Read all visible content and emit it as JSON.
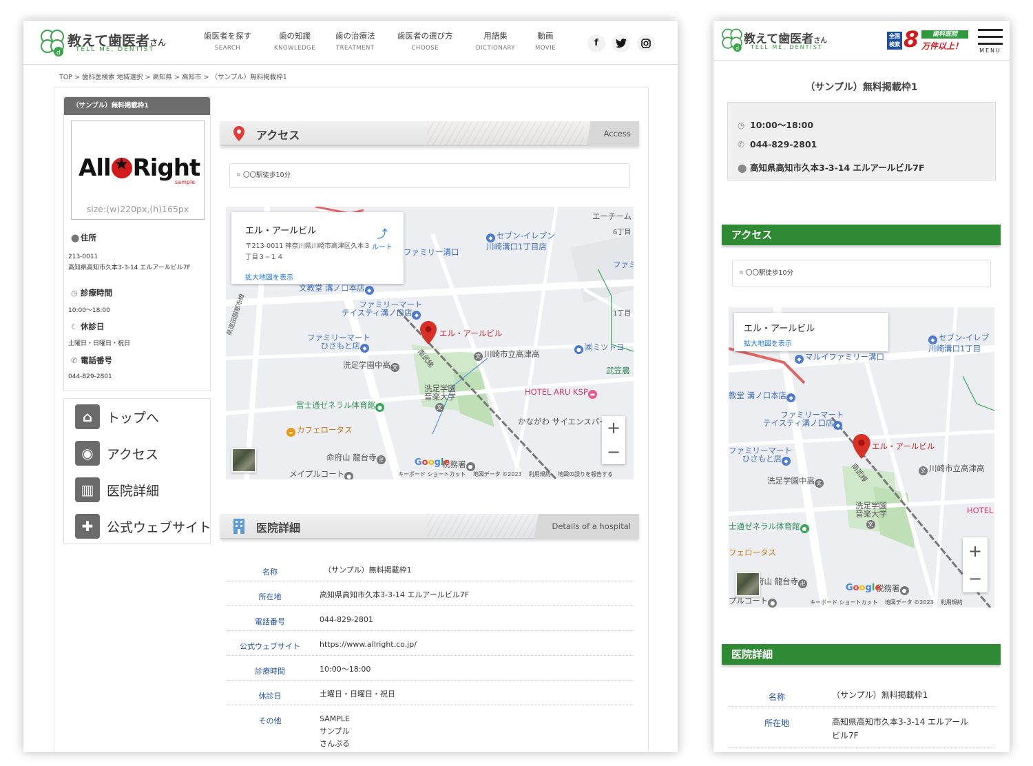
{
  "brand": {
    "name": "教えて歯医者",
    "name_suffix": "さん",
    "tagline": "TELL ME, DENTIST"
  },
  "nav": [
    {
      "jp": "歯医者を探す",
      "en": "SEARCH"
    },
    {
      "jp": "歯の知識",
      "en": "KNOWLEDGE"
    },
    {
      "jp": "歯の治療法",
      "en": "TREATMENT"
    },
    {
      "jp": "歯医者の選び方",
      "en": "CHOOSE"
    },
    {
      "jp": "用語集",
      "en": "DICTIONARY"
    },
    {
      "jp": "動画",
      "en": "MOVIE"
    }
  ],
  "sns": {
    "facebook": "f",
    "twitter": "t",
    "instagram": "◎"
  },
  "breadcrumb": "TOP > 歯科医検索 地域選択 > 高知県 > 高知市 > （サンプル）無料掲載枠1",
  "clinic": {
    "card_title": "（サンプル）無料掲載枠1",
    "title": "（サンプル）無料掲載枠1",
    "logo_text_left": "All",
    "logo_text_right": "Right",
    "logo_sample": "sample",
    "image_size_note": "size:(w)220px,(h)165px",
    "address_label": "住所",
    "postal": "213-0011",
    "address": "高知県高知市久本3-3-14 エルアールビル7F",
    "hours_label": "診療時間",
    "hours": "10:00〜18:00",
    "closed_label": "休診日",
    "closed": "土曜日・日曜日・祝日",
    "phone_label": "電話番号",
    "phone": "044-829-2801"
  },
  "side_nav": [
    {
      "label": "トップへ",
      "icon": "home-icon"
    },
    {
      "label": "アクセス",
      "icon": "pin-icon"
    },
    {
      "label": "医院詳細",
      "icon": "building-icon"
    },
    {
      "label": "公式ウェブサイト",
      "icon": "plus-icon"
    }
  ],
  "access": {
    "title": "アクセス",
    "en": "Access",
    "walk": "〇〇駅徒歩10分"
  },
  "map": {
    "place_name": "エル・アールビル",
    "place_address": "〒213-0011 神奈川県川崎市高津区久本３丁目３−１４",
    "enlarge_link": "拡大地図を表示",
    "route": "ルート",
    "labels": {
      "seven": "セブン-イレブン\n川崎溝口1丁目店",
      "seven_m": "セブン-イレブ\n川崎溝口1丁目",
      "famima_mizonokuchi": "ファミリー溝口",
      "famima_mizonokuchi_m": "マルイファミリー溝口",
      "bunkyodo": "文教堂 溝ノ口本店",
      "bunkyodo_m": "教堂 溝ノ口本店",
      "famima_teisty": "ファミリーマート\nテイスティ溝ノ口店",
      "famima_hisamoto": "ファミリーマート\nひさもと店",
      "pin": "エル・アールビル",
      "kawasaki_high": "川崎市立高津高",
      "senzoku_mid": "洗足学園中高",
      "senzoku_music": "洗足学園\n音楽大学",
      "fujitsu": "富士通ゼネラル体育館",
      "fujitsu_m": "士通ゼネラル体育館",
      "cafe": "カフェロータス",
      "cafe_m": "フェロータス",
      "ryodaiji": "命府山 龍台寺",
      "ryodaiji_m": "府山 龍台寺",
      "maple": "メイプルコート",
      "maple_m": "プルコート",
      "hotel": "HOTEL ARU KSP",
      "hotel_m": "HOTEL",
      "science_park": "かながわ\nサイエンスパーク",
      "zeimusho": "税務署",
      "mitsutoyo": "㈱ミツトヨ",
      "takezasa": "武笠農",
      "ace": "エーチーム",
      "chome6": "6丁目",
      "chome1": "1丁目",
      "famima_kawasaki": "ファミ\n川崎",
      "nanbu": "南武線",
      "kenshoku": "県道田園都市線"
    },
    "footer": {
      "shortcuts": "キーボード ショートカット",
      "data": "地図データ ©2023",
      "terms": "利用規約",
      "report": "地図の誤りを報告する"
    }
  },
  "details": {
    "title": "医院詳細",
    "en": "Details of a hospital",
    "rows": [
      {
        "key": "名称",
        "value": "（サンプル）無料掲載枠1"
      },
      {
        "key": "所在地",
        "value": "高知県高知市久本3-3-14 エルアールビル7F"
      },
      {
        "key": "電話番号",
        "value": "044-829-2801"
      },
      {
        "key": "公式ウェブサイト",
        "value": "https://www.allright.co.jp/"
      },
      {
        "key": "診療時間",
        "value": "10:00〜18:00"
      },
      {
        "key": "休診日",
        "value": "土曜日・日曜日・祝日"
      },
      {
        "key": "その他",
        "value": "SAMPLE\nサンプル\nさんぷる"
      }
    ],
    "mobile_address_wrapped": "高知県高知市久本3-3-14 エルアール\nビル7F"
  },
  "mobile": {
    "badge_national": "全国\n検索",
    "badge_number": "8",
    "badge_clinic": "歯科医院",
    "badge_count": "万件以上！",
    "menu": "MENU"
  },
  "colors": {
    "green": "#2e8b34",
    "link_blue": "#2255aa",
    "pin_red": "#d93025"
  }
}
